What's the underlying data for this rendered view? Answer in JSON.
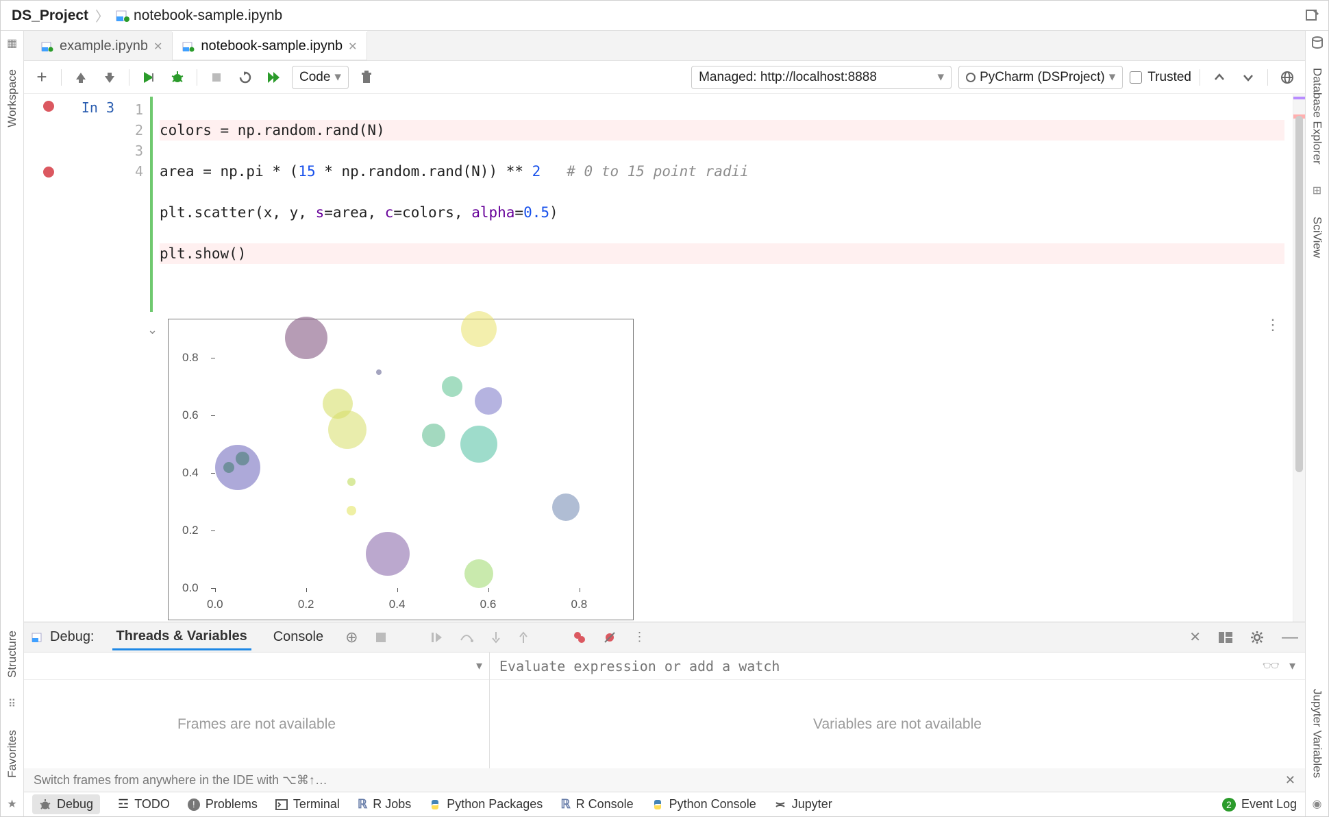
{
  "breadcrumb": {
    "project": "DS_Project",
    "file": "notebook-sample.ipynb"
  },
  "tabs": [
    {
      "label": "example.ipynb",
      "active": false
    },
    {
      "label": "notebook-sample.ipynb",
      "active": true
    }
  ],
  "toolbar": {
    "cell_type": "Code",
    "kernel": "Managed: http://localhost:8888",
    "interpreter": "PyCharm (DSProject)",
    "trusted_label": "Trusted"
  },
  "left_strip": {
    "workspace": "Workspace",
    "structure": "Structure",
    "favorites": "Favorites"
  },
  "right_strip": {
    "db": "Database Explorer",
    "sciview": "SciView",
    "jvars": "Jupyter Variables"
  },
  "cell": {
    "prompt": "In 3",
    "lines": [
      "1",
      "2",
      "3",
      "4"
    ],
    "code": {
      "l1_pre": "colors = np.random.rand(N)",
      "l2_pre": "area = np.pi * (",
      "l2_num1": "15",
      "l2_mid": " * np.random.rand(N)) ** ",
      "l2_num2": "2",
      "l2_comment": "   # 0 to 15 point radii",
      "l3_pre": "plt.scatter(x, y, ",
      "l3_arg1": "s",
      "l3_eq1": "=area, ",
      "l3_arg2": "c",
      "l3_eq2": "=colors, ",
      "l3_arg3": "alpha",
      "l3_eq3": "=",
      "l3_num": "0.5",
      "l3_close": ")",
      "l4": "plt.show()"
    }
  },
  "chart_data": {
    "type": "scatter",
    "title": "",
    "xlabel": "",
    "ylabel": "",
    "xlim": [
      0.0,
      0.9
    ],
    "ylim": [
      0.0,
      0.9
    ],
    "xticks": [
      0.0,
      0.2,
      0.4,
      0.6,
      0.8
    ],
    "yticks": [
      0.0,
      0.2,
      0.4,
      0.6,
      0.8
    ],
    "points": [
      {
        "x": 0.2,
        "y": 0.87,
        "size": 62,
        "color": "#7a4b79"
      },
      {
        "x": 0.58,
        "y": 0.9,
        "size": 52,
        "color": "#e9e16a"
      },
      {
        "x": 0.36,
        "y": 0.75,
        "size": 8,
        "color": "#5a5a8a"
      },
      {
        "x": 0.52,
        "y": 0.7,
        "size": 30,
        "color": "#59c18e"
      },
      {
        "x": 0.6,
        "y": 0.65,
        "size": 40,
        "color": "#7975c6"
      },
      {
        "x": 0.27,
        "y": 0.64,
        "size": 44,
        "color": "#d3dd5e"
      },
      {
        "x": 0.29,
        "y": 0.55,
        "size": 56,
        "color": "#d7df68"
      },
      {
        "x": 0.48,
        "y": 0.53,
        "size": 34,
        "color": "#58b98a"
      },
      {
        "x": 0.58,
        "y": 0.5,
        "size": 54,
        "color": "#4fc0a0"
      },
      {
        "x": 0.05,
        "y": 0.42,
        "size": 66,
        "color": "#6a63b9"
      },
      {
        "x": 0.06,
        "y": 0.45,
        "size": 20,
        "color": "#3e7a6a"
      },
      {
        "x": 0.03,
        "y": 0.42,
        "size": 16,
        "color": "#3e7a6a"
      },
      {
        "x": 0.3,
        "y": 0.37,
        "size": 12,
        "color": "#b9d94f"
      },
      {
        "x": 0.3,
        "y": 0.27,
        "size": 14,
        "color": "#e2e35a"
      },
      {
        "x": 0.77,
        "y": 0.28,
        "size": 40,
        "color": "#6f87b0"
      },
      {
        "x": 0.38,
        "y": 0.12,
        "size": 64,
        "color": "#8360a5"
      },
      {
        "x": 0.58,
        "y": 0.05,
        "size": 42,
        "color": "#9cd96a"
      }
    ]
  },
  "debug": {
    "title": "Debug:",
    "tabs": {
      "threads": "Threads & Variables",
      "console": "Console"
    },
    "frames_empty": "Frames are not available",
    "vars_empty": "Variables are not available",
    "watch_placeholder": "Evaluate expression or add a watch",
    "hint": "Switch frames from anywhere in the IDE with ⌥⌘↑…"
  },
  "status": {
    "debug": "Debug",
    "todo": "TODO",
    "problems": "Problems",
    "terminal": "Terminal",
    "rjobs": "R Jobs",
    "pypkg": "Python Packages",
    "rconsole": "R Console",
    "pyconsole": "Python Console",
    "jupyter": "Jupyter",
    "eventlog": "Event Log",
    "eventlog_count": "2"
  }
}
